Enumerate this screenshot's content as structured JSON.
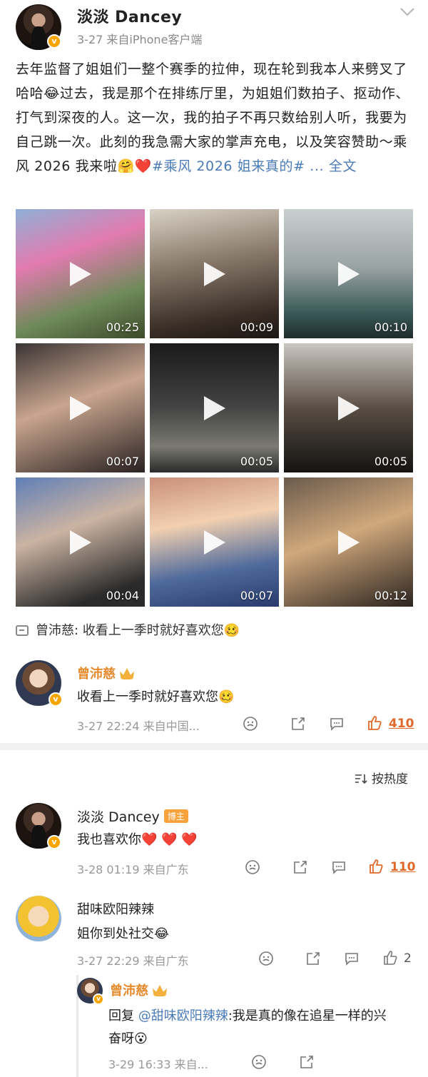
{
  "post": {
    "author": "淡淡 Dancey",
    "meta": "3-27  来自iPhone客户端",
    "text_main": "去年监督了姐姐们一整个赛季的拉伸，现在轮到我本人来劈叉了哈哈",
    "text_2": "过去，我是那个在排练厅里，为姐姐们数拍子、抠动作、打气到深夜的人。这一次，我的拍子不再只数给别人听，我要为自己跳一次。此刻的我急需大家的掌声充电，以及笑容赞助～乘风 2026 我来啦",
    "hashtag": "#乘风 2026 姐来真的#",
    "more": "... 全文",
    "emoji_laugh": "😂",
    "emoji_hug": "🤗",
    "emoji_heart": "❤️",
    "videos": [
      {
        "duration": "00:25"
      },
      {
        "duration": "00:09"
      },
      {
        "duration": "00:10"
      },
      {
        "duration": "00:07"
      },
      {
        "duration": "00:05"
      },
      {
        "duration": "00:05"
      },
      {
        "duration": "00:04"
      },
      {
        "duration": "00:07"
      },
      {
        "duration": "00:12"
      }
    ]
  },
  "forward": {
    "text": "曾沛慈: 收看上一季时就好喜欢您🥴"
  },
  "top_comment": {
    "name": "曾沛慈",
    "text": "收看上一季时就好喜欢您🥴",
    "meta": "3-27 22:24  来自中国...",
    "likes": "410"
  },
  "sort_label": "按热度",
  "comments": [
    {
      "name": "淡淡 Dancey",
      "badge": "博主",
      "text": "我也喜欢你❤️ ❤️ ❤️",
      "meta": "3-28 01:19  来自广东",
      "likes": "110"
    },
    {
      "name": "甜味欧阳辣辣",
      "text": "姐你到处社交😂",
      "meta": "3-27 22:29  来自广东",
      "likes": "2"
    }
  ],
  "reply": {
    "name": "曾沛慈",
    "prefix": "回复 ",
    "at": "@甜味欧阳辣辣",
    "text_1": ":我是真的像在追星一样的兴",
    "text_2": "奋呀😮",
    "meta": "3-29 16:33  来自..."
  },
  "colors": {
    "accent_orange": "#e68a2e",
    "link_blue": "#4a7bb7",
    "like_hot": "#e0692a"
  }
}
